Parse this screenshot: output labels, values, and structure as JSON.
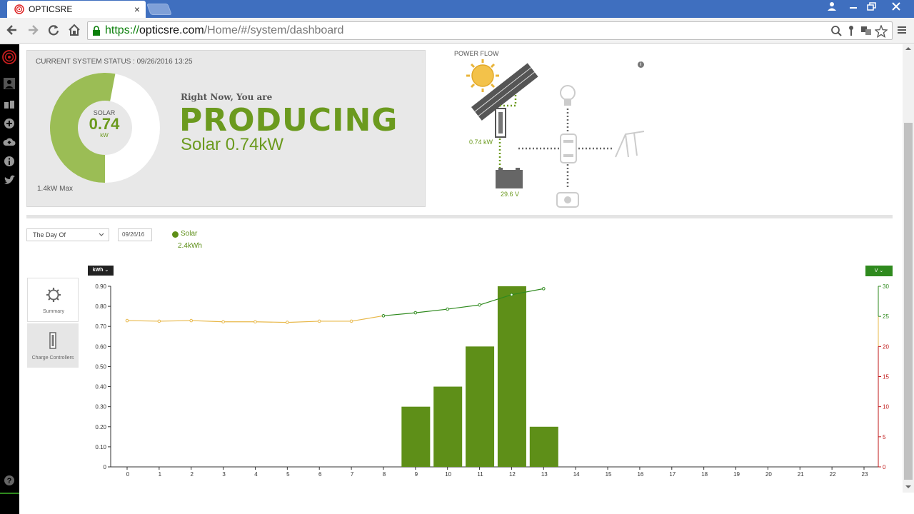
{
  "browser": {
    "tab_title": "OPTICSRE",
    "tab_close": "×",
    "url_scheme": "https://",
    "url_host": "opticsre.com",
    "url_path": "/Home/#/system/dashboard"
  },
  "status": {
    "label": "CURRENT SYSTEM STATUS : 09/26/2016 13:25",
    "donut_label": "SOLAR",
    "donut_value": "0.74",
    "donut_unit": "kW",
    "donut_fraction": 0.53,
    "max_label": "1.4kW Max",
    "right_now": "Right Now, You are",
    "state": "PRODUCING",
    "solar_now": "Solar  0.74kW"
  },
  "power_flow": {
    "title": "POWER FLOW",
    "info": "i",
    "pv_kw": "0.74 kW",
    "battery_v": "29.6 V"
  },
  "controls": {
    "range_select": "The Day Of",
    "date": "09/26/16",
    "legend_name": "Solar",
    "legend_total": "2.4kWh",
    "unit_button": "kWh ⌄",
    "v_button": "V   ⌄"
  },
  "views": {
    "summary": "Summary",
    "charge_controllers": "Charge Controllers"
  },
  "colors": {
    "accent": "#6b9a1e",
    "bar": "#5e8f18",
    "line_green": "#2f8a1e",
    "line_amber": "#e8b84a",
    "axis_red": "#c01818"
  },
  "chart_data": {
    "type": "bar",
    "x": [
      0,
      1,
      2,
      3,
      4,
      5,
      6,
      7,
      8,
      9,
      10,
      11,
      12,
      13,
      14,
      15,
      16,
      17,
      18,
      19,
      20,
      21,
      22,
      23
    ],
    "x_ticks": [
      "0",
      "1",
      "2",
      "3",
      "4",
      "5",
      "6",
      "7",
      "8",
      "9",
      "10",
      "11",
      "12",
      "13",
      "14",
      "15",
      "16",
      "17",
      "18",
      "19",
      "20",
      "21",
      "22",
      "23"
    ],
    "ylim": [
      0,
      0.9
    ],
    "y_ticks": [
      "0",
      "0.10",
      "0.20",
      "0.30",
      "0.40",
      "0.50",
      "0.60",
      "0.70",
      "0.80",
      "0.90"
    ],
    "y2lim": [
      0,
      30
    ],
    "y2_ticks": [
      "0",
      "5",
      "10",
      "15",
      "20",
      "25",
      "30"
    ],
    "series": [
      {
        "name": "Solar",
        "kind": "bar",
        "values": [
          0,
          0,
          0,
          0,
          0,
          0,
          0,
          0,
          0,
          0.3,
          0.4,
          0.6,
          0.9,
          0.2,
          0,
          0,
          0,
          0,
          0,
          0,
          0,
          0,
          0,
          0
        ]
      },
      {
        "kind": "line",
        "axis": "right",
        "x": [
          0,
          1,
          2,
          3,
          4,
          5,
          6,
          7,
          8,
          9,
          10,
          11,
          12,
          13
        ],
        "values": [
          24.3,
          24.2,
          24.3,
          24.1,
          24.1,
          24.0,
          24.2,
          24.2,
          25.1,
          25.6,
          26.2,
          26.9,
          28.6,
          29.6
        ]
      }
    ]
  }
}
